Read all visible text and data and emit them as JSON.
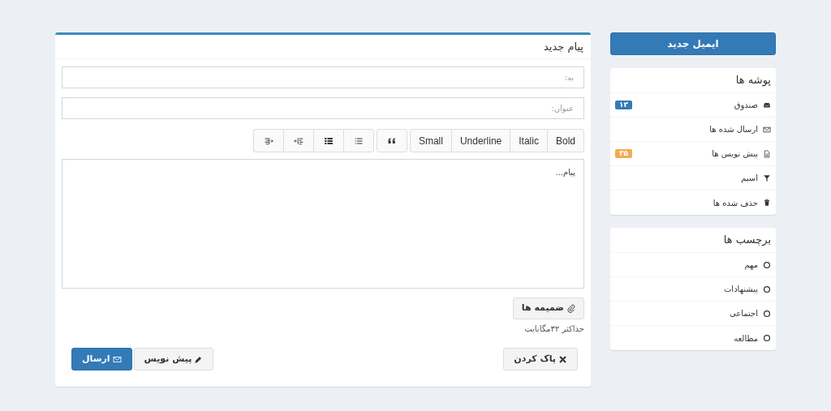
{
  "compose_button": "ایمیل جدید",
  "folders": {
    "title": "پوشه ها",
    "items": [
      {
        "kind": "inbox",
        "label": "صندوق",
        "badge": "۱۲",
        "color": "#337ab7"
      },
      {
        "kind": "envelope",
        "label": "ارسال شده ها"
      },
      {
        "kind": "file",
        "label": "پیش نویس ها",
        "badge": "۳۵",
        "color": "#f0ad4e"
      },
      {
        "kind": "filter",
        "label": "اسپم"
      },
      {
        "kind": "trash",
        "label": "حذف شده ها"
      }
    ]
  },
  "labels": {
    "title": "برچسب ها",
    "items": [
      {
        "label": "مهم"
      },
      {
        "label": "پیشنهادات"
      },
      {
        "label": "اجتماعی"
      },
      {
        "label": "مطالعه"
      }
    ]
  },
  "compose": {
    "title": "پیام جدید",
    "to": {
      "placeholder": "به:"
    },
    "subject": {
      "placeholder": "عنوان:"
    },
    "toolbar": [
      [
        {
          "kind": "text",
          "label": "Bold"
        },
        {
          "kind": "text",
          "label": "Italic"
        },
        {
          "kind": "text",
          "label": "Underline"
        },
        {
          "kind": "text",
          "label": "Small"
        }
      ],
      [
        {
          "kind": "quote"
        }
      ],
      [
        {
          "kind": "list"
        },
        {
          "kind": "list-bold"
        },
        {
          "kind": "outdent"
        },
        {
          "kind": "indent"
        }
      ]
    ],
    "body": {
      "placeholder": "پیام..."
    },
    "attach_button": "ضمیمه ها",
    "attach_hint": "حداکثر ۳۲مگابایت",
    "discard_button": "پاک کردن",
    "draft_button": "پیش نویس",
    "send_button": "ارسال"
  }
}
